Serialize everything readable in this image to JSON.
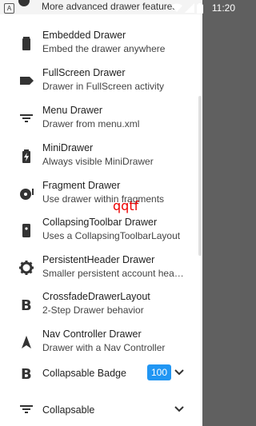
{
  "status_bar": {
    "time": "11:20",
    "left_icon_letter": "A"
  },
  "top_item": {
    "label": "More advanced drawer features"
  },
  "items": [
    {
      "title": "Embedded Drawer",
      "subtitle": "Embed the drawer anywhere",
      "icon": "battery-icon"
    },
    {
      "title": "FullScreen Drawer",
      "subtitle": "Drawer in FullScreen activity",
      "icon": "label-icon"
    },
    {
      "title": "Menu Drawer",
      "subtitle": "Drawer from menu.xml",
      "icon": "sort-icon"
    },
    {
      "title": "MiniDrawer",
      "subtitle": "Always visible MiniDrawer",
      "icon": "battery-charging-icon"
    },
    {
      "title": "Fragment Drawer",
      "subtitle": "Use drawer within fragments",
      "icon": "disc-icon"
    },
    {
      "title": "CollapsingToolbar Drawer",
      "subtitle": "Uses a CollapsingToolbarLayout",
      "icon": "phone-device-icon"
    },
    {
      "title": "PersistentHeader Drawer",
      "subtitle": "Smaller persistent account hea…",
      "icon": "gear-icon"
    },
    {
      "title": "CrossfadeDrawerLayout",
      "subtitle": "2-Step Drawer behavior",
      "icon": "bold-b-icon"
    },
    {
      "title": "Nav Controller Drawer",
      "subtitle": "Drawer with a Nav Controller",
      "icon": "navigation-arrow-icon"
    }
  ],
  "collapsable_badge": {
    "title": "Collapsable Badge",
    "badge": "100",
    "icon": "bold-b-icon"
  },
  "collapsable": {
    "title": "Collapsable",
    "icon": "sort-icon"
  },
  "overlay_text": "qqtf",
  "colors": {
    "badge": "#2196f3",
    "overlay": "#ee0000",
    "scrim": "#606060"
  }
}
